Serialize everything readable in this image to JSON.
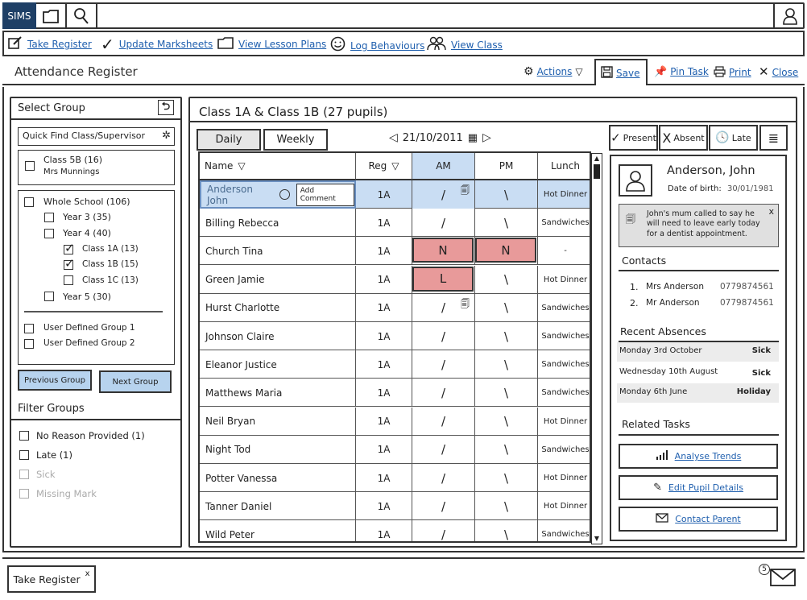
{
  "topbar": {
    "logo": "SIMS",
    "folder_icon": "folder-icon",
    "search_icon": "search-icon",
    "user_icon": "user-icon"
  },
  "quicklinks": [
    {
      "label": "Take Register",
      "icon": "edit-icon"
    },
    {
      "label": "Update Marksheets",
      "icon": "check-icon"
    },
    {
      "label": "View Lesson Plans",
      "icon": "folder-icon"
    },
    {
      "label": "Log Behaviours",
      "icon": "smiley-icon"
    },
    {
      "label": "View Class",
      "icon": "group-icon"
    }
  ],
  "titlebar": {
    "title": "Attendance Register",
    "actions": "Actions",
    "save": "Save",
    "pin_task": "Pin Task",
    "print": "Print",
    "close": "Close"
  },
  "left": {
    "select_group": "Select Group",
    "quick_find_placeholder": "Quick Find Class/Supervisor",
    "current_class": "Class 5B (16)",
    "current_teacher": "Mrs Munnings",
    "tree": [
      {
        "label": "Whole School (106)",
        "checked": false
      },
      {
        "label": "Year 3 (35)",
        "checked": false
      },
      {
        "label": "Year 4 (40)",
        "checked": false
      },
      {
        "label": "Class 1A (13)",
        "checked": true
      },
      {
        "label": "Class 1B (15)",
        "checked": true
      },
      {
        "label": "Class 1C (13)",
        "checked": false
      },
      {
        "label": "Year 5 (30)",
        "checked": false
      },
      {
        "label": "User Defined Group 1",
        "checked": false
      },
      {
        "label": "User Defined Group 2",
        "checked": false
      }
    ],
    "prev_group": "Previous Group",
    "next_group": "Next Group",
    "filter_title": "Filter Groups",
    "filters": [
      {
        "label": "No Reason Provided (1)",
        "disabled": false
      },
      {
        "label": "Late (1)",
        "disabled": false
      },
      {
        "label": "Sick",
        "disabled": true
      },
      {
        "label": "Missing Mark",
        "disabled": true
      }
    ]
  },
  "center": {
    "heading": "Class 1A & Class 1B (27 pupils)",
    "tab_daily": "Daily",
    "tab_weekly": "Weekly",
    "date": "21/10/2011",
    "btn_present": "Present",
    "btn_absent": "Absent",
    "btn_late": "Late",
    "columns": {
      "name": "Name",
      "reg": "Reg",
      "am": "AM",
      "pm": "PM",
      "lunch": "Lunch"
    },
    "add_comment": "Add Comment",
    "rows": [
      {
        "name": "Anderson John",
        "reg": "1A",
        "am": "/",
        "pm": "\\",
        "lunch": "Hot Dinner"
      },
      {
        "name": "Billing Rebecca",
        "reg": "1A",
        "am": "/",
        "pm": "\\",
        "lunch": "Sandwiches"
      },
      {
        "name": "Church Tina",
        "reg": "1A",
        "am": "N",
        "pm": "N",
        "lunch": "-"
      },
      {
        "name": "Green Jamie",
        "reg": "1A",
        "am": "L",
        "pm": "\\",
        "lunch": "Hot Dinner"
      },
      {
        "name": "Hurst Charlotte",
        "reg": "1A",
        "am": "/",
        "pm": "\\",
        "lunch": "Sandwiches"
      },
      {
        "name": "Johnson Claire",
        "reg": "1A",
        "am": "/",
        "pm": "\\",
        "lunch": "Sandwiches"
      },
      {
        "name": "Eleanor Justice",
        "reg": "1A",
        "am": "/",
        "pm": "\\",
        "lunch": "Sandwiches"
      },
      {
        "name": "Matthews Maria",
        "reg": "1A",
        "am": "/",
        "pm": "\\",
        "lunch": "Sandwiches"
      },
      {
        "name": "Neil Bryan",
        "reg": "1A",
        "am": "/",
        "pm": "\\",
        "lunch": "Hot Dinner"
      },
      {
        "name": "Night Tod",
        "reg": "1A",
        "am": "/",
        "pm": "\\",
        "lunch": "Sandwiches"
      },
      {
        "name": "Potter Vanessa",
        "reg": "1A",
        "am": "/",
        "pm": "\\",
        "lunch": "Hot Dinner"
      },
      {
        "name": "Tanner Daniel",
        "reg": "1A",
        "am": "/",
        "pm": "\\",
        "lunch": "Hot Dinner"
      },
      {
        "name": "Wild Peter",
        "reg": "1A",
        "am": "/",
        "pm": "\\",
        "lunch": "Sandwiches"
      }
    ]
  },
  "pupil": {
    "name": "Anderson, John",
    "dob_label": "Date of birth:",
    "dob": "30/01/1981",
    "note": "John's mum called to say he will need to leave early today for a dentist appointment.",
    "contacts_title": "Contacts",
    "contacts": [
      {
        "num": "1.",
        "name": "Mrs Anderson",
        "phone": "0779874561"
      },
      {
        "num": "2.",
        "name": "Mr Anderson",
        "phone": "0779874561"
      }
    ],
    "absences_title": "Recent Absences",
    "absences": [
      {
        "date": "Monday 3rd October",
        "reason": "Sick"
      },
      {
        "date": "Wednesday 10th August",
        "reason": "Sick"
      },
      {
        "date": "Monday 6th June",
        "reason": "Holiday"
      }
    ],
    "tasks_title": "Related Tasks",
    "tasks": [
      {
        "label": "Analyse Trends",
        "icon": "bar-chart-icon"
      },
      {
        "label": "Edit Pupil Details",
        "icon": "pencil-icon"
      },
      {
        "label": "Contact Parent",
        "icon": "envelope-icon"
      }
    ]
  },
  "footer": {
    "tab_label": "Take Register",
    "mail_count": "5"
  },
  "colors": {
    "logo_bg": "#1e3f66",
    "link": "#1f5fae",
    "selected_row": "#c9ddf3",
    "absent_cell": "#e89a9a",
    "button_blue": "#b7d3ee"
  }
}
